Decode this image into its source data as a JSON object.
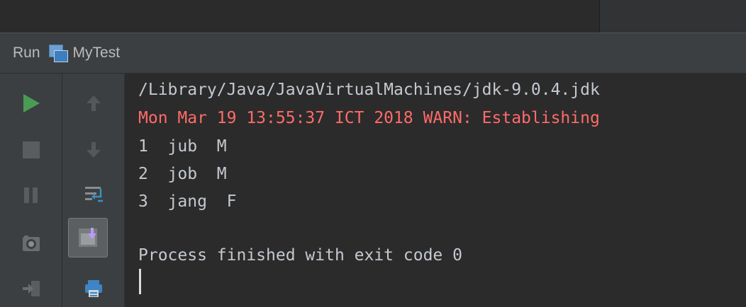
{
  "header": {
    "run_label": "Run",
    "config_icon": "run-configuration-icon",
    "config_name": "MyTest"
  },
  "toolbar": {
    "rerun_icon": "rerun-icon",
    "stop_icon": "stop-icon",
    "pause_icon": "pause-icon",
    "dump_threads_icon": "camera-icon",
    "exit_icon": "exit-icon",
    "up_icon": "arrow-up-icon",
    "down_icon": "arrow-down-icon",
    "soft_wrap_icon": "soft-wrap-icon",
    "scroll_to_end_icon": "scroll-to-end-icon",
    "print_icon": "print-icon"
  },
  "console": {
    "lines": [
      {
        "text": "/Library/Java/JavaVirtualMachines/jdk-9.0.4.jdk",
        "color": "#c4c9d0"
      },
      {
        "text": "Mon Mar 19 13:55:37 ICT 2018 WARN: Establishing",
        "color": "#ff6b68"
      },
      {
        "text": "1  jub  M",
        "color": "#c4c9d0"
      },
      {
        "text": "2  job  M",
        "color": "#c4c9d0"
      },
      {
        "text": "3  jang  F",
        "color": "#c4c9d0"
      },
      {
        "text": "",
        "color": "#c4c9d0"
      },
      {
        "text": "Process finished with exit code 0",
        "color": "#c4c9d0"
      }
    ]
  },
  "colors": {
    "background": "#2b2b2b",
    "panel": "#3c3f41",
    "run_green": "#499c54",
    "error_red": "#ff6b68",
    "accent_purple": "#b99bf8"
  }
}
